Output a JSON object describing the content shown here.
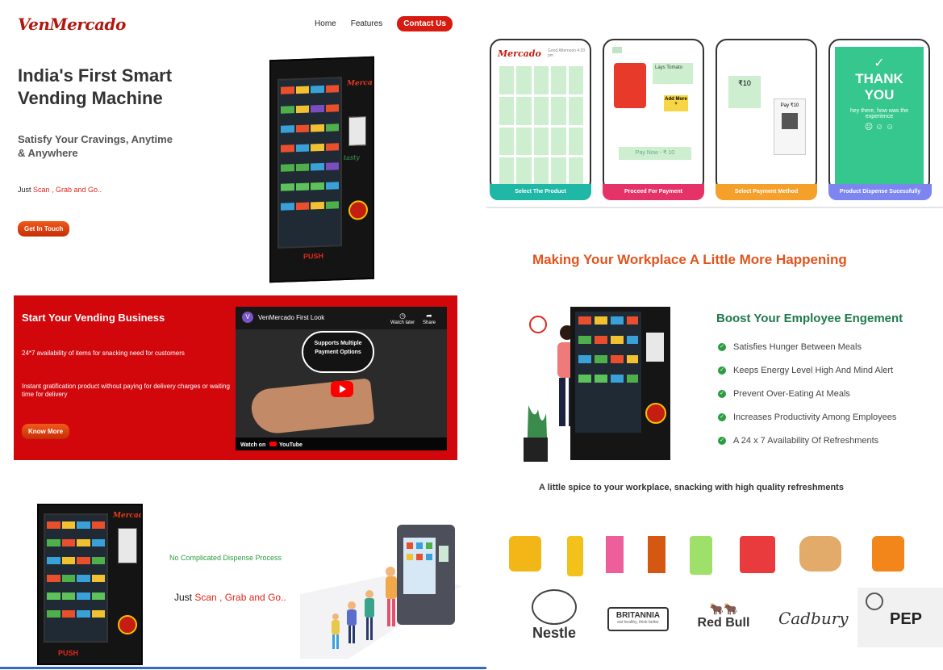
{
  "colors": {
    "brand_red": "#d1070c",
    "accent_orange": "#e2541c",
    "green": "#1e7a4c"
  },
  "header": {
    "logo": "VenMercado",
    "nav": [
      {
        "label": "Home"
      },
      {
        "label": "Features"
      }
    ],
    "contact_label": "Contact Us"
  },
  "hero": {
    "title": "India's First Smart Vending Machine",
    "subtitle": "Satisfy Your Cravings, Anytime & Anywhere",
    "scan_prefix": "Just ",
    "scan_highlight": "Scan , Grab and Go..",
    "cta_label": "Get In Touch"
  },
  "vending_business": {
    "title": "Start Your Vending Business",
    "point_1": "24*7 availability of items for snacking need for customers",
    "point_2": "Instant gratification product without paying for delivery charges or waiting time for delivery",
    "cta_label": "Know More",
    "video": {
      "channel_initial": "V",
      "title": "VenMercado First Look",
      "watch_later": "Watch later",
      "share": "Share",
      "bubble": "Supports Multiple Payment Options",
      "watch_on": "Watch on",
      "platform": "YouTube"
    }
  },
  "dispense": {
    "no_complicated": "No Complicated Dispense Process",
    "scan_prefix": "Just ",
    "scan_highlight": "Scan , Grab and Go.."
  },
  "machine_art": {
    "brand": "Mercado",
    "push": "PUSH",
    "doodle": "tasty"
  },
  "steps": [
    {
      "label": "Select The Product",
      "color": "#1fb7a5"
    },
    {
      "label": "Proceed For Payment",
      "color": "#e5336a"
    },
    {
      "label": "Select Payment Method",
      "color": "#f5a02b"
    },
    {
      "label": "Product Dispense Sucessfully",
      "color": "#7d86f0"
    }
  ],
  "phones": {
    "select": {
      "brand": "Mercado",
      "greeting": "Good Afternoon 4:20 pm"
    },
    "proceed": {
      "product": "Lays Tomato",
      "add_more": "Add More +",
      "pay_now": "Pay Now - ₹ 10"
    },
    "method": {
      "amount": "₹10",
      "pay": "Pay ₹10"
    },
    "thanks": {
      "check": "✓",
      "thank": "THANK",
      "you": "YOU",
      "msg": "hey there, how was the experience"
    }
  },
  "workplace": {
    "heading": "Making Your Workplace A Little More Happening",
    "boost_title": "Boost Your Employee Engement",
    "benefits": [
      "Satisfies Hunger Between Meals",
      "Keeps Energy Level High And Mind Alert",
      "Prevent Over-Eating At Meals",
      "Increases Productivity Among Employees",
      "A 24 x 7 Availability Of Refreshments"
    ],
    "tagline": "A little spice to your workplace, snacking with high quality refreshments"
  },
  "brands": [
    "Nestle",
    "BRITANNIA",
    "Red Bull",
    "Cadbury",
    "PEP"
  ],
  "brand_sub": {
    "britannia_tag": "eat healthy, think better"
  }
}
